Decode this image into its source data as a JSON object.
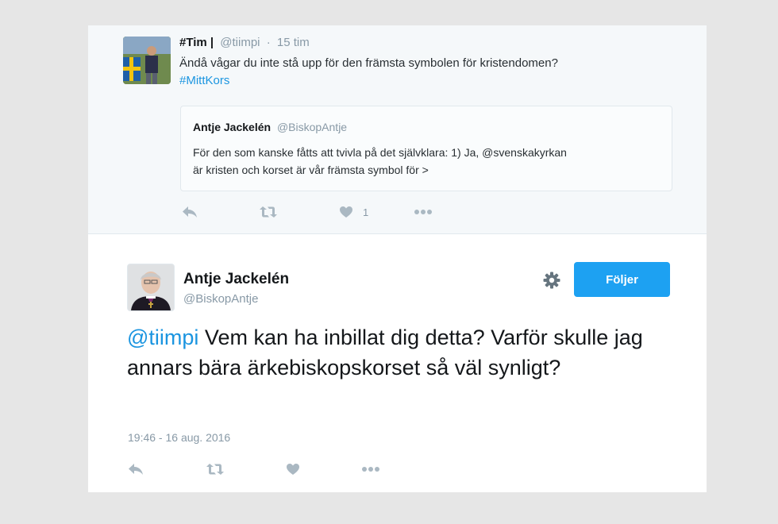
{
  "parent_tweet": {
    "name": "#Tim |",
    "handle": "@tiimpi",
    "separator": "·",
    "time": "15 tim",
    "text": "Ändå vågar du inte stå upp för den främsta symbolen för kristendomen?",
    "hashtag": "#MittKors",
    "like_count": "1",
    "quote": {
      "name": "Antje Jackelén",
      "handle": "@BiskopAntje",
      "text_line1": "För den som kanske fåtts att tvivla på det självklara: 1) Ja, @svenskakyrkan",
      "text_line2": "är kristen och korset är vår främsta symbol för >"
    }
  },
  "main_tweet": {
    "name": "Antje Jackelén",
    "handle": "@BiskopAntje",
    "follow_label": "Följer",
    "mention": "@tiimpi",
    "text": " Vem kan ha inbillat dig detta? Varför skulle jag annars bära ärkebiskopskorset så väl synligt?",
    "timestamp": "19:46 - 16 aug. 2016"
  },
  "icons": {
    "reply": "reply-icon",
    "retweet": "retweet-icon",
    "like": "heart-icon",
    "more": "more-icon",
    "settings": "gear-icon"
  },
  "colors": {
    "link": "#1b95e0",
    "button": "#1da1f2",
    "action_icon": "#aab8c2",
    "muted_text": "#8899a6"
  }
}
